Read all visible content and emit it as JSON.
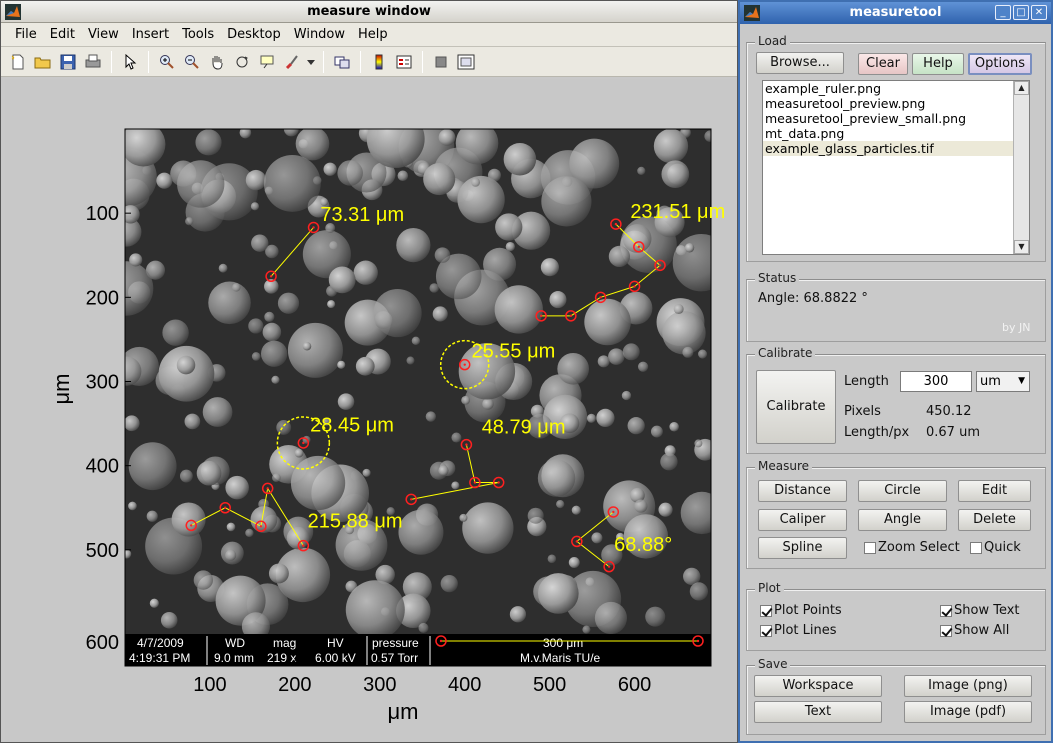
{
  "measure_window": {
    "title": "measure window",
    "menu": [
      "File",
      "Edit",
      "View",
      "Insert",
      "Tools",
      "Desktop",
      "Window",
      "Help"
    ],
    "toolbar_icons": [
      "new-file-icon",
      "open-folder-icon",
      "save-icon",
      "print-icon",
      "pointer-icon",
      "zoom-in-icon",
      "zoom-out-icon",
      "pan-hand-icon",
      "rotate-3d-icon",
      "data-cursor-icon",
      "brush-icon",
      "link-icon",
      "colorbar-icon",
      "legend-icon",
      "hide-tools-icon",
      "show-tools-icon"
    ],
    "plot": {
      "xlabel": "μm",
      "ylabel": "μm",
      "xticks": [
        "100",
        "200",
        "300",
        "400",
        "500",
        "600"
      ],
      "yticks": [
        "100",
        "200",
        "300",
        "400",
        "500",
        "600"
      ],
      "xlim": [
        0,
        690
      ],
      "ylim": [
        600,
        0
      ],
      "accent_color": "#ffff00",
      "marker_color": "#ff2020",
      "measurements": [
        {
          "type": "distance",
          "label": "73.31 μm",
          "points": [
            [
              222,
              117
            ],
            [
              172,
              175
            ]
          ],
          "label_at": [
            230,
            100
          ]
        },
        {
          "type": "spline",
          "label": "231.51 μm",
          "points": [
            [
              578,
              113
            ],
            [
              605,
              140
            ],
            [
              630,
              162
            ],
            [
              600,
              187
            ],
            [
              560,
              200
            ],
            [
              525,
              222
            ],
            [
              490,
              222
            ]
          ],
          "label_at": [
            595,
            96
          ]
        },
        {
          "type": "circle",
          "label": "25.55 μm",
          "center": [
            400,
            280
          ],
          "radius": 24,
          "label_at": [
            408,
            262
          ]
        },
        {
          "type": "circle",
          "label": "28.45 μm",
          "center": [
            210,
            373
          ],
          "radius": 26,
          "label_at": [
            218,
            350
          ]
        },
        {
          "type": "caliper",
          "label": "48.79 μm",
          "points": [
            [
              402,
              375
            ],
            [
              412,
              420
            ],
            [
              440,
              420
            ],
            [
              337,
              440
            ]
          ],
          "label_at": [
            420,
            352
          ]
        },
        {
          "type": "spline",
          "label": "215.88 μm",
          "points": [
            [
              78,
              471
            ],
            [
              118,
              450
            ],
            [
              160,
              472
            ],
            [
              168,
              427
            ],
            [
              210,
              495
            ]
          ],
          "label_at": [
            215,
            464
          ]
        },
        {
          "type": "angle",
          "label": "68.88°",
          "points": [
            [
              575,
              455
            ],
            [
              532,
              490
            ],
            [
              570,
              520
            ]
          ],
          "label_at": [
            576,
            492
          ]
        }
      ],
      "databar": {
        "date": "4/7/2009",
        "time": "4:19:31 PM",
        "wd_label": "WD",
        "wd": "9.0 mm",
        "mag_label": "mag",
        "mag": "219 x",
        "hv_label": "HV",
        "hv": "6.00 kV",
        "pressure_label": "pressure",
        "pressure": "0.57 Torr",
        "scale_label": "300 μm",
        "credit": "M.v.Maris TU/e"
      }
    }
  },
  "measuretool": {
    "title": "measuretool",
    "load": {
      "legend": "Load",
      "browse": "Browse...",
      "clear": "Clear",
      "help": "Help",
      "options": "Options",
      "files": [
        "example_ruler.png",
        "measuretool_preview.png",
        "measuretool_preview_small.png",
        "mt_data.png",
        "example_glass_particles.tif"
      ],
      "selected_index": 4
    },
    "status": {
      "legend": "Status",
      "text": "Angle: 68.8822 °",
      "credit": "by JN"
    },
    "calibrate": {
      "legend": "Calibrate",
      "button": "Calibrate",
      "length_label": "Length",
      "length_value": "300",
      "unit": "um",
      "pixels_label": "Pixels",
      "pixels_value": "450.12",
      "lpx_label": "Length/px",
      "lpx_value": "0.67 um"
    },
    "measure": {
      "legend": "Measure",
      "buttons": [
        "Distance",
        "Circle",
        "Edit",
        "Caliper",
        "Angle",
        "Delete",
        "Spline"
      ],
      "zoom_select": "Zoom Select",
      "quick": "Quick"
    },
    "plot": {
      "legend": "Plot",
      "plot_points": "Plot Points",
      "show_text": "Show Text",
      "plot_lines": "Plot Lines",
      "show_all": "Show All"
    },
    "save": {
      "legend": "Save",
      "workspace": "Workspace",
      "image_png": "Image (png)",
      "text": "Text",
      "image_pdf": "Image (pdf)"
    }
  }
}
